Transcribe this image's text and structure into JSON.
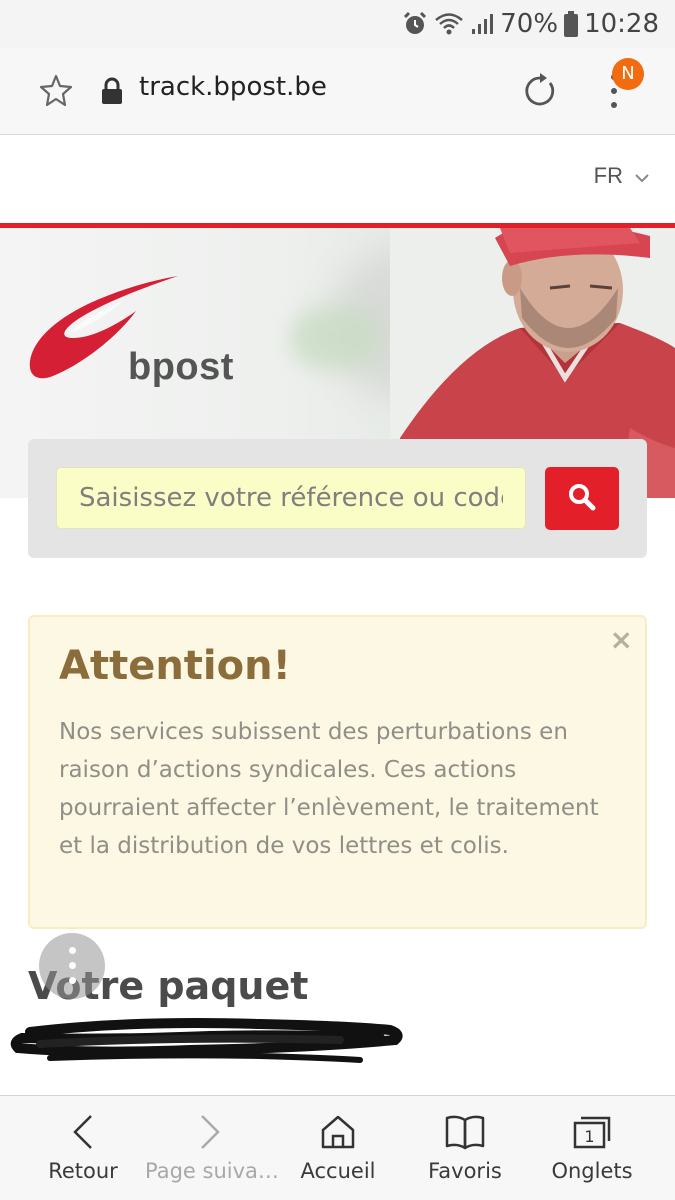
{
  "status_bar": {
    "battery_percent": "70%",
    "time": "10:28"
  },
  "browser": {
    "url": "track.bpost.be",
    "notification_badge": "N",
    "badge_color": "#f26b0f"
  },
  "language": {
    "selected": "FR"
  },
  "brand": {
    "name": "bpost",
    "accent": "#e3202a"
  },
  "search": {
    "placeholder": "Saisissez votre référence ou code"
  },
  "alert": {
    "close": "×",
    "title": "Attention!",
    "body": "Nos services subissent des perturbations en raison d’actions syndicales. Ces actions pourraient affecter l’enlèvement, le traitement et la distribution de vos lettres et colis."
  },
  "package": {
    "title": "Votre paquet"
  },
  "bottom_nav": {
    "items": [
      {
        "label": "Retour",
        "icon": "chevron-left-icon",
        "enabled": true
      },
      {
        "label": "Page suiva…",
        "icon": "chevron-right-icon",
        "enabled": false
      },
      {
        "label": "Accueil",
        "icon": "home-icon",
        "enabled": true
      },
      {
        "label": "Favoris",
        "icon": "book-icon",
        "enabled": true
      },
      {
        "label": "Onglets",
        "icon": "tabs-icon",
        "enabled": true,
        "count": "1"
      }
    ]
  }
}
